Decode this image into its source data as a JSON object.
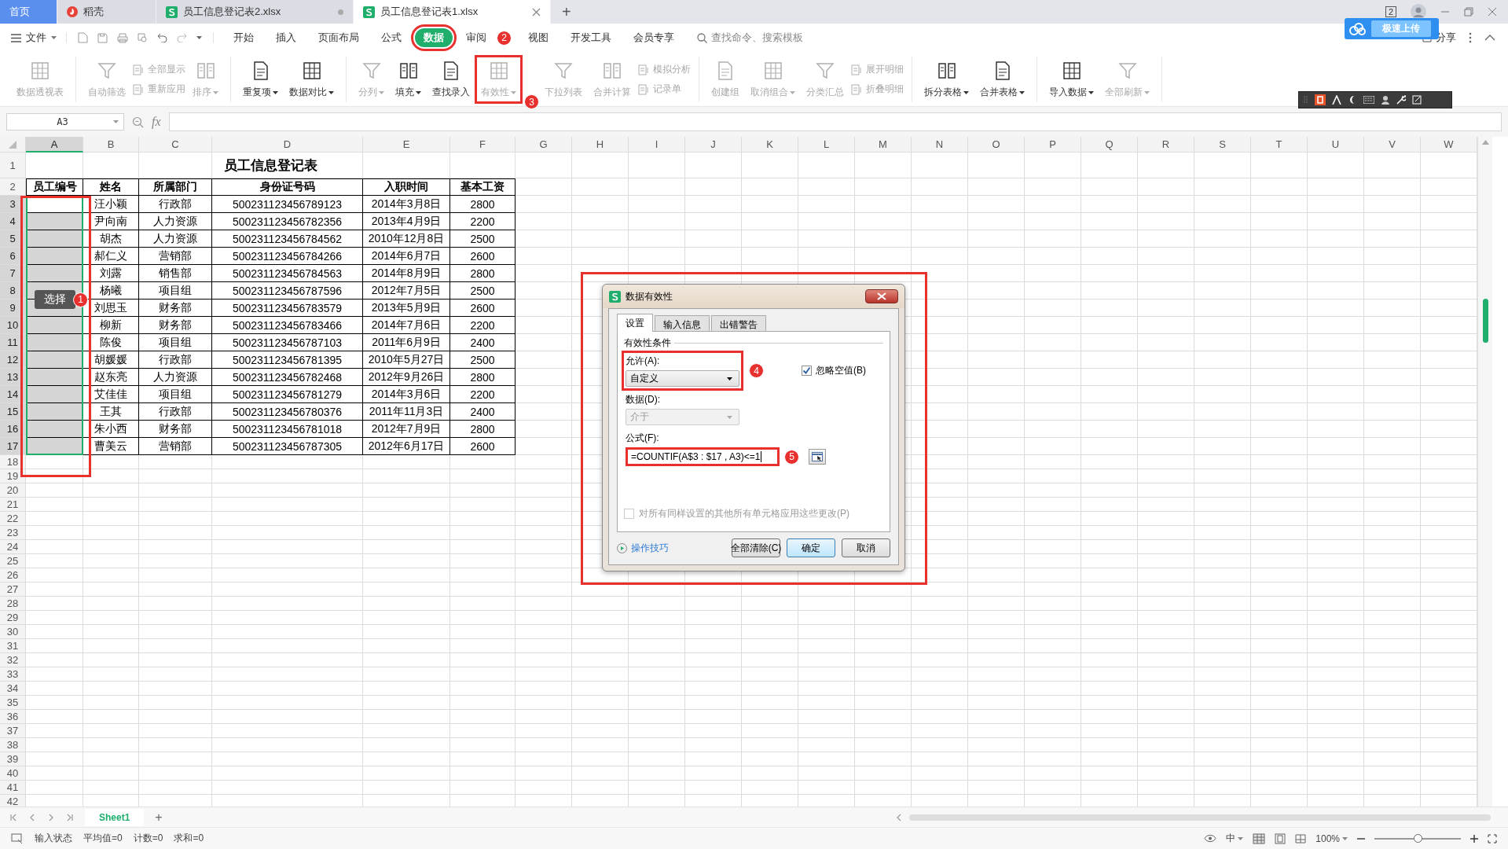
{
  "title_bar": {
    "tabs": [
      {
        "kind": "home",
        "label": "首页",
        "selected": false
      },
      {
        "kind": "docer",
        "label": "稻壳",
        "selected": false
      },
      {
        "kind": "sheet",
        "label": "员工信息登记表2.xlsx",
        "selected": false
      },
      {
        "kind": "sheet",
        "label": "员工信息登记表1.xlsx",
        "selected": true
      }
    ],
    "new_tab": "+",
    "window_count": "2"
  },
  "menu": {
    "file": "文件",
    "items": [
      {
        "label": "开始",
        "selected": false
      },
      {
        "label": "插入",
        "selected": false
      },
      {
        "label": "页面布局",
        "selected": false
      },
      {
        "label": "公式",
        "selected": false
      },
      {
        "label": "数据",
        "selected": true,
        "marked": true
      },
      {
        "label": "审阅",
        "selected": false,
        "badge": "2"
      },
      {
        "label": "视图",
        "selected": false
      },
      {
        "label": "开发工具",
        "selected": false
      },
      {
        "label": "会员专享",
        "selected": false
      }
    ],
    "search_placeholder": "查找命令、搜索模板",
    "upload_popup": "极速上传",
    "share": "分享"
  },
  "ribbon": {
    "groups": [
      {
        "items": [
          {
            "kind": "large",
            "label": "数据透视表",
            "disabled": true,
            "dropdown": false
          }
        ]
      },
      {
        "items": [
          {
            "kind": "large",
            "label": "自动筛选",
            "disabled": true,
            "dropdown": false
          },
          {
            "kind": "stack",
            "items": [
              {
                "label": "全部显示",
                "disabled": true
              },
              {
                "label": "重新应用",
                "disabled": true
              }
            ]
          },
          {
            "kind": "large",
            "label": "排序",
            "disabled": true,
            "dropdown": true
          }
        ]
      },
      {
        "items": [
          {
            "kind": "large",
            "label": "重复项",
            "disabled": false,
            "dropdown": true
          },
          {
            "kind": "large",
            "label": "数据对比",
            "disabled": false,
            "dropdown": true
          }
        ]
      },
      {
        "items": [
          {
            "kind": "large",
            "label": "分列",
            "disabled": true,
            "dropdown": true
          },
          {
            "kind": "large",
            "label": "填充",
            "disabled": false,
            "dropdown": true
          },
          {
            "kind": "large",
            "label": "查找录入",
            "disabled": false,
            "dropdown": false
          },
          {
            "kind": "large",
            "label": "有效性",
            "disabled": true,
            "dropdown": true,
            "marked": true,
            "badge": "3"
          },
          {
            "kind": "large",
            "label": "下拉列表",
            "disabled": true,
            "dropdown": false
          },
          {
            "kind": "large",
            "label": "合并计算",
            "disabled": true,
            "dropdown": false
          },
          {
            "kind": "stack",
            "items": [
              {
                "label": "模拟分析",
                "disabled": true
              },
              {
                "label": "记录单",
                "disabled": true
              }
            ]
          }
        ]
      },
      {
        "items": [
          {
            "kind": "large",
            "label": "创建组",
            "disabled": true,
            "dropdown": false
          },
          {
            "kind": "large",
            "label": "取消组合",
            "disabled": true,
            "dropdown": true
          },
          {
            "kind": "large",
            "label": "分类汇总",
            "disabled": true,
            "dropdown": false
          },
          {
            "kind": "stack",
            "items": [
              {
                "label": "展开明细",
                "disabled": true
              },
              {
                "label": "折叠明细",
                "disabled": true
              }
            ]
          }
        ]
      },
      {
        "items": [
          {
            "kind": "large",
            "label": "拆分表格",
            "disabled": false,
            "dropdown": true
          },
          {
            "kind": "large",
            "label": "合并表格",
            "disabled": false,
            "dropdown": true
          }
        ]
      },
      {
        "items": [
          {
            "kind": "large",
            "label": "导入数据",
            "disabled": false,
            "dropdown": true
          },
          {
            "kind": "large",
            "label": "全部刷新",
            "disabled": true,
            "dropdown": true
          }
        ]
      }
    ]
  },
  "formula_bar": {
    "name_box": "A3",
    "fx": "fx"
  },
  "sheet": {
    "column_headers": [
      "A",
      "B",
      "C",
      "D",
      "E",
      "F",
      "G",
      "H",
      "I",
      "J",
      "K",
      "L",
      "M",
      "N",
      "O",
      "P",
      "Q",
      "R",
      "S",
      "T",
      "U",
      "V",
      "W"
    ],
    "row_headers": [
      "1",
      "2",
      "3",
      "4",
      "5",
      "6",
      "7",
      "8",
      "9",
      "10",
      "11",
      "12",
      "13",
      "14",
      "15",
      "16",
      "17",
      "18",
      "19",
      "20",
      "21",
      "22",
      "23",
      "24",
      "25",
      "26",
      "27",
      "28",
      "29",
      "30",
      "31",
      "32",
      "33",
      "34",
      "35",
      "36",
      "37",
      "38",
      "39",
      "40",
      "41",
      "42"
    ],
    "title": "员工信息登记表",
    "columns": [
      "员工编号",
      "姓名",
      "所属部门",
      "身份证号码",
      "入职时间",
      "基本工资"
    ],
    "rows": [
      {
        "selected": true,
        "cells": [
          "",
          "汪小颖",
          "行政部",
          "500231123456789123",
          "2014年3月8日",
          "2800"
        ]
      },
      {
        "selected": true,
        "cells": [
          "",
          "尹向南",
          "人力资源",
          "500231123456782356",
          "2013年4月9日",
          "2200"
        ]
      },
      {
        "selected": true,
        "cells": [
          "",
          "胡杰",
          "人力资源",
          "500231123456784562",
          "2010年12月8日",
          "2500"
        ]
      },
      {
        "selected": true,
        "cells": [
          "",
          "郝仁义",
          "营销部",
          "500231123456784266",
          "2014年6月7日",
          "2600"
        ]
      },
      {
        "selected": true,
        "cells": [
          "",
          "刘露",
          "销售部",
          "500231123456784563",
          "2014年8月9日",
          "2800"
        ]
      },
      {
        "selected": true,
        "cells": [
          "",
          "杨曦",
          "项目组",
          "500231123456787596",
          "2012年7月5日",
          "2500"
        ]
      },
      {
        "selected": true,
        "cells": [
          "",
          "刘思玉",
          "财务部",
          "500231123456783579",
          "2013年5月9日",
          "2600"
        ]
      },
      {
        "selected": true,
        "cells": [
          "",
          "柳新",
          "财务部",
          "500231123456783466",
          "2014年7月6日",
          "2200"
        ]
      },
      {
        "selected": true,
        "cells": [
          "",
          "陈俊",
          "项目组",
          "500231123456787103",
          "2011年6月9日",
          "2400"
        ]
      },
      {
        "selected": true,
        "cells": [
          "",
          "胡媛媛",
          "行政部",
          "500231123456781395",
          "2010年5月27日",
          "2500"
        ]
      },
      {
        "selected": true,
        "cells": [
          "",
          "赵东亮",
          "人力资源",
          "500231123456782468",
          "2012年9月26日",
          "2800"
        ]
      },
      {
        "selected": true,
        "cells": [
          "",
          "艾佳佳",
          "项目组",
          "500231123456781279",
          "2014年3月6日",
          "2200"
        ]
      },
      {
        "selected": true,
        "cells": [
          "",
          "王其",
          "行政部",
          "500231123456780376",
          "2011年11月3日",
          "2400"
        ]
      },
      {
        "selected": true,
        "cells": [
          "",
          "朱小西",
          "财务部",
          "500231123456781018",
          "2012年7月9日",
          "2800"
        ]
      },
      {
        "selected": true,
        "cells": [
          "",
          "曹美云",
          "营销部",
          "500231123456787305",
          "2012年6月17日",
          "2600"
        ]
      }
    ],
    "marked": true,
    "badge": "1",
    "tooltip": "选择"
  },
  "dialog": {
    "marked": true,
    "title": "数据有效性",
    "tabs": [
      {
        "label": "设置",
        "selected": true
      },
      {
        "label": "输入信息",
        "selected": false
      },
      {
        "label": "出错警告",
        "selected": false
      }
    ],
    "section": "有效性条件",
    "allow": {
      "label": "允许(A):",
      "value": "自定义",
      "marked": true,
      "badge": "4"
    },
    "ignore_blank": {
      "label": "忽略空值(B)",
      "checked": true
    },
    "data": {
      "label": "数据(D):",
      "value": "介于",
      "disabled": true
    },
    "formula": {
      "label": "公式(F):",
      "value": "=COUNTIF(A$3 : $17 , A3)<=1",
      "marked": true,
      "badge": "5"
    },
    "apply_all": {
      "label": "对所有同样设置的其他所有单元格应用这些更改(P)",
      "checked": false,
      "disabled": true
    },
    "tips": "操作技巧",
    "buttons": [
      {
        "label": "全部清除(C)",
        "default": false
      },
      {
        "label": "确定",
        "default": true
      },
      {
        "label": "取消",
        "default": false
      }
    ]
  },
  "sheet_tabs": {
    "tabs": [
      {
        "label": "Sheet1",
        "selected": true
      }
    ],
    "add": "+"
  },
  "status_bar": {
    "mode": "输入状态",
    "stats": [
      "平均值=0",
      "计数=0",
      "求和=0"
    ],
    "input_lang": "中",
    "zoom": "100%",
    "zoom_slider": {
      "level": 0.5
    }
  }
}
